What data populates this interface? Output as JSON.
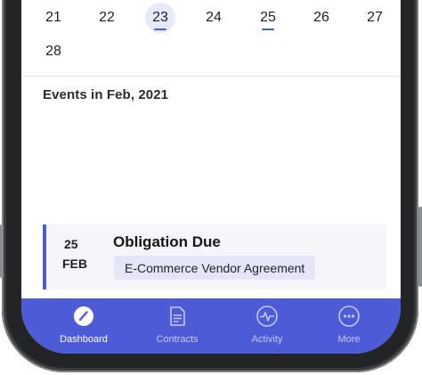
{
  "calendar": {
    "week_row": [
      "21",
      "22",
      "23",
      "24",
      "25",
      "26",
      "27"
    ],
    "last_row": [
      "28"
    ],
    "selected_day": "23",
    "event_days": [
      "23",
      "25"
    ]
  },
  "events": {
    "heading": "Events in Feb, 2021",
    "items": [
      {
        "day": "25",
        "month": "FEB",
        "title": "Obligation Due",
        "contract": "E-Commerce Vendor Agreement"
      }
    ]
  },
  "tabbar": {
    "tabs": [
      {
        "label": "Dashboard",
        "icon": "dashboard-gauge-icon",
        "active": true
      },
      {
        "label": "Contracts",
        "icon": "document-icon",
        "active": false
      },
      {
        "label": "Activity",
        "icon": "activity-pulse-icon",
        "active": false
      },
      {
        "label": "More",
        "icon": "more-dots-icon",
        "active": false
      }
    ]
  },
  "colors": {
    "accent": "#4e5bd6",
    "selected_day_bg": "#e8eafb",
    "card_bg": "#f5f5fa",
    "chip_bg": "#e4e6f8"
  }
}
